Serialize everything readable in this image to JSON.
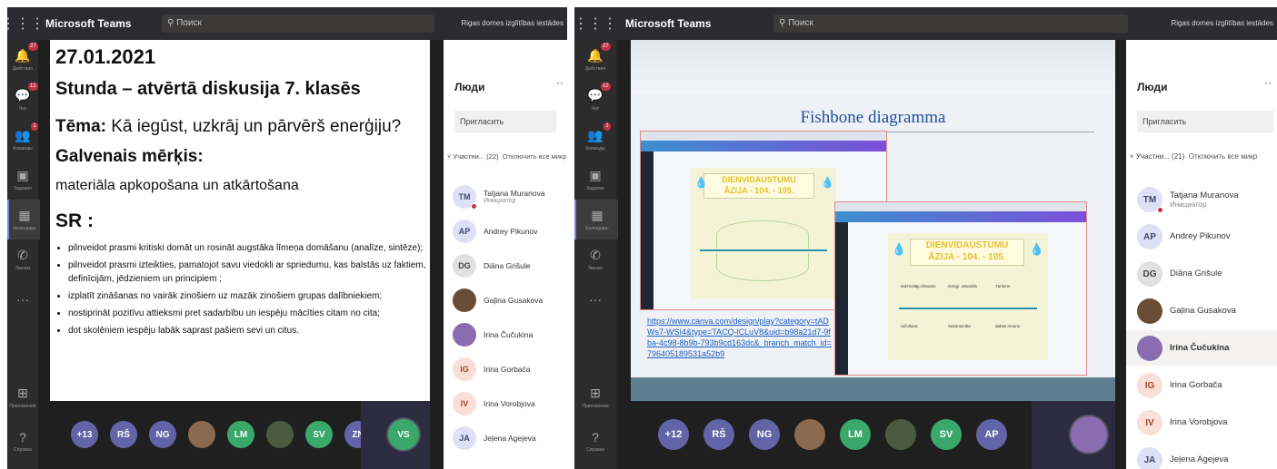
{
  "app": {
    "name": "Microsoft Teams",
    "search_placeholder": "Поиск",
    "org": "Rigas domes izglītības iestādes"
  },
  "colors": {
    "topbar": "#2b2b30",
    "rail": "#2d2c2c",
    "accent": "#7b83eb",
    "presence_busy": "#c4314b",
    "link": "#1f5fc5",
    "slide_title": "#1f4e9f"
  },
  "left": {
    "rail": [
      {
        "icon": "bell-icon",
        "label": "Действия",
        "badge": "27"
      },
      {
        "icon": "chat-icon",
        "label": "Чат",
        "badge": "12"
      },
      {
        "icon": "teams-icon",
        "label": "Команды",
        "badge": "1"
      },
      {
        "icon": "assignments-icon",
        "label": "Задания",
        "badge": ""
      },
      {
        "icon": "calendar-icon",
        "label": "Календарь",
        "badge": ""
      },
      {
        "icon": "calls-icon",
        "label": "Звонки",
        "badge": ""
      },
      {
        "icon": "more-icon",
        "label": "",
        "badge": ""
      },
      {
        "icon": "apps-icon",
        "label": "Приложения",
        "badge": ""
      },
      {
        "icon": "help-icon",
        "label": "Справка",
        "badge": ""
      }
    ],
    "slide": {
      "date": "27.01.2021",
      "heading": "Stunda – atvērtā diskusija 7. klasēs",
      "topic_label": "Tēma:",
      "topic_text": " Kā iegūst, uzkrāj un pārvērš enerģiju?",
      "goal_label": "Galvenais mērķis:",
      "goal_text": "materiāla apkopošana un atkārtošana",
      "sr_label": "SR :",
      "bullets": [
        "pilnveidot prasmi kritiski domāt un rosināt augstāka līmeņa domāšanu (analīze, sintēze);",
        "pilnveidot prasmi izteikties, pamatojot savu viedokli ar spriedumu, kas balstās uz faktiem, definīcijām, jēdzieniem un principiem ;",
        "izplatīt zināšanas no vairāk zinošiem uz mazāk zinošiem grupas dalībniekiem;",
        "nostiprināt pozitīvu attieksmi pret sadarbību un iespēju mācīties citam no cita;",
        "dot skolēniem iespēju labāk saprast pašiem sevi un citus."
      ]
    },
    "panel": {
      "title": "Люди",
      "more": "··",
      "invite": "Пригласить",
      "participants_label": "Участни... (22)",
      "mute_all": "Отключить все микр",
      "people": [
        {
          "initials": "TM",
          "name": "Tatjana Muranova",
          "role": "Инициатор",
          "color": "#dfe0f5",
          "fg": "#464775",
          "presence": "busy"
        },
        {
          "initials": "AP",
          "name": "Andrey Pikunov",
          "role": "",
          "color": "#dfe0f5",
          "fg": "#464775",
          "presence": ""
        },
        {
          "initials": "DG",
          "name": "Diāna Grišule",
          "role": "",
          "color": "#e1e1e1",
          "fg": "#444",
          "presence": ""
        },
        {
          "initials": "",
          "name": "Gaļina Gusakova",
          "role": "",
          "color": "#6b4d36",
          "fg": "#fff",
          "presence": "",
          "photo": true
        },
        {
          "initials": "",
          "name": "Irina Čučukina",
          "role": "",
          "color": "#8a6db0",
          "fg": "#fff",
          "presence": "",
          "photo": true
        },
        {
          "initials": "IG",
          "name": "Irina Gorbača",
          "role": "",
          "color": "#f9dfd7",
          "fg": "#a8442a",
          "presence": ""
        },
        {
          "initials": "IV",
          "name": "Irina Vorobjova",
          "role": "",
          "color": "#f9dfd7",
          "fg": "#a8442a",
          "presence": ""
        },
        {
          "initials": "JA",
          "name": "Jeļena Agejeva",
          "role": "",
          "color": "#dfe0f5",
          "fg": "#464775",
          "presence": ""
        }
      ]
    },
    "strip": [
      {
        "label": "+13",
        "color": "#6264a7"
      },
      {
        "label": "RŠ",
        "color": "#6264a7"
      },
      {
        "label": "NG",
        "color": "#6264a7"
      },
      {
        "label": "",
        "color": "#8a6a50",
        "photo": true
      },
      {
        "label": "LM",
        "color": "#3aa86b"
      },
      {
        "label": "",
        "color": "#4a5a40",
        "photo": true
      },
      {
        "label": "SV",
        "color": "#3aa86b"
      },
      {
        "label": "ZN",
        "color": "#6264a7"
      },
      {
        "label": "VS",
        "color": "#3aa86b"
      }
    ]
  },
  "right": {
    "rail": [
      {
        "icon": "bell-icon",
        "label": "Действия",
        "badge": "27"
      },
      {
        "icon": "chat-icon",
        "label": "Чат",
        "badge": "12"
      },
      {
        "icon": "teams-icon",
        "label": "Команды",
        "badge": "1"
      },
      {
        "icon": "assignments-icon",
        "label": "Задания",
        "badge": ""
      },
      {
        "icon": "calendar-icon",
        "label": "Календарь",
        "badge": ""
      },
      {
        "icon": "calls-icon",
        "label": "Звонки",
        "badge": ""
      },
      {
        "icon": "more-icon",
        "label": "",
        "badge": ""
      },
      {
        "icon": "apps-icon",
        "label": "Приложения",
        "badge": ""
      },
      {
        "icon": "help-icon",
        "label": "Справка",
        "badge": ""
      }
    ],
    "slide": {
      "title": "Fishbone diagramma",
      "canva_heading_1": "DIENVIDAUSTUMU",
      "canva_heading_2": "ĀZIJA - 104. - 105.",
      "link": "https://www.canva.com/design/play?category=tADWs7-WSI4&type=TACQ-lCLuV8&uid=b98a21d7-9fba-4c98-8b9b-793b9cd163dc&_branch_match_id=796405189531a52b9",
      "bone_labels": [
        "Ģeografiskais stāvoklis",
        "Iedzīvotāji",
        "Klimats",
        "dabas resursi",
        "Saimniecība, tūrisms",
        "pilsētas"
      ],
      "bone_labels_2": [
        "Iedzīvotāju blīvums",
        "Ģeogr. stāvoklis",
        "Tūrisms",
        "ražošana",
        "Saimniecība",
        "dabas resursi"
      ]
    },
    "panel": {
      "title": "Люди",
      "more": "··",
      "invite": "Пригласить",
      "participants_label": "Участни... (21)",
      "mute_all": "Отключить все микр",
      "people": [
        {
          "initials": "TM",
          "name": "Tatjana Muranova",
          "role": "Инициатор",
          "color": "#dfe0f5",
          "fg": "#464775",
          "presence": "busy"
        },
        {
          "initials": "AP",
          "name": "Andrey Pikunov",
          "role": "",
          "color": "#dfe0f5",
          "fg": "#464775",
          "presence": ""
        },
        {
          "initials": "DG",
          "name": "Diāna Grišule",
          "role": "",
          "color": "#e1e1e1",
          "fg": "#444",
          "presence": ""
        },
        {
          "initials": "",
          "name": "Gaļina Gusakova",
          "role": "",
          "color": "#6b4d36",
          "fg": "#fff",
          "presence": "",
          "photo": true
        },
        {
          "initials": "",
          "name": "Irina Čučukina",
          "role": "",
          "color": "#8a6db0",
          "fg": "#fff",
          "presence": "",
          "photo": true,
          "highlight": true
        },
        {
          "initials": "IG",
          "name": "Irina Gorbača",
          "role": "",
          "color": "#f9dfd7",
          "fg": "#a8442a",
          "presence": ""
        },
        {
          "initials": "IV",
          "name": "Irina Vorobjova",
          "role": "",
          "color": "#f9dfd7",
          "fg": "#a8442a",
          "presence": ""
        },
        {
          "initials": "JA",
          "name": "Jeļena Agejeva",
          "role": "",
          "color": "#dfe0f5",
          "fg": "#464775",
          "presence": ""
        }
      ]
    },
    "strip": [
      {
        "label": "+12",
        "color": "#6264a7"
      },
      {
        "label": "RŠ",
        "color": "#6264a7"
      },
      {
        "label": "NG",
        "color": "#6264a7"
      },
      {
        "label": "",
        "color": "#8a6a50",
        "photo": true
      },
      {
        "label": "LM",
        "color": "#3aa86b"
      },
      {
        "label": "",
        "color": "#4a5a40",
        "photo": true
      },
      {
        "label": "SV",
        "color": "#3aa86b"
      },
      {
        "label": "AP",
        "color": "#6264a7"
      },
      {
        "label": "",
        "color": "#8a6db0",
        "photo": true
      }
    ]
  }
}
